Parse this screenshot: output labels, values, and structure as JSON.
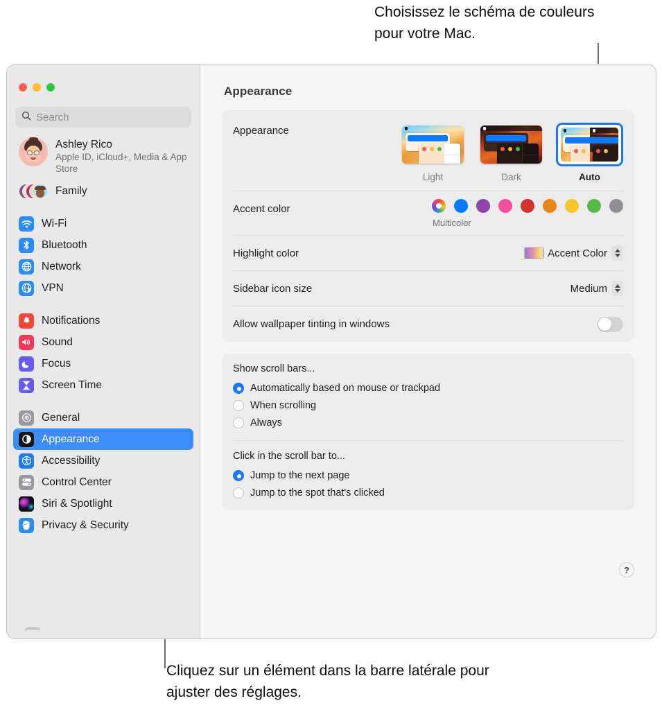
{
  "callouts": {
    "top": "Choisissez le schéma de couleurs pour votre Mac.",
    "bottom": "Cliquez sur un élément dans la barre latérale pour ajuster des réglages."
  },
  "window": {
    "title": "Appearance",
    "traffic_lights": [
      "close-button",
      "minimize-button",
      "zoom-button"
    ]
  },
  "sidebar": {
    "search": {
      "placeholder": "Search",
      "value": "",
      "icon": "search-icon"
    },
    "account": {
      "name": "Ashley Rico",
      "subtitle": "Apple ID, iCloud+, Media & App Store"
    },
    "family": {
      "label": "Family"
    },
    "groups": [
      {
        "items": [
          {
            "label": "Wi-Fi",
            "icon": "wifi-icon",
            "selected": false
          },
          {
            "label": "Bluetooth",
            "icon": "bluetooth-icon",
            "selected": false
          },
          {
            "label": "Network",
            "icon": "network-icon",
            "selected": false
          },
          {
            "label": "VPN",
            "icon": "vpn-icon",
            "selected": false
          }
        ]
      },
      {
        "items": [
          {
            "label": "Notifications",
            "icon": "notifications-icon",
            "selected": false
          },
          {
            "label": "Sound",
            "icon": "sound-icon",
            "selected": false
          },
          {
            "label": "Focus",
            "icon": "focus-icon",
            "selected": false
          },
          {
            "label": "Screen Time",
            "icon": "screen-time-icon",
            "selected": false
          }
        ]
      },
      {
        "items": [
          {
            "label": "General",
            "icon": "general-icon",
            "selected": false
          },
          {
            "label": "Appearance",
            "icon": "appearance-icon",
            "selected": true
          },
          {
            "label": "Accessibility",
            "icon": "accessibility-icon",
            "selected": false
          },
          {
            "label": "Control Center",
            "icon": "control-center-icon",
            "selected": false
          },
          {
            "label": "Siri & Spotlight",
            "icon": "siri-spotlight-icon",
            "selected": false
          },
          {
            "label": "Privacy & Security",
            "icon": "privacy-security-icon",
            "selected": false
          }
        ]
      }
    ]
  },
  "main": {
    "appearance": {
      "label": "Appearance",
      "options": [
        {
          "name": "Light",
          "selected": false
        },
        {
          "name": "Dark",
          "selected": false
        },
        {
          "name": "Auto",
          "selected": true
        }
      ]
    },
    "accent_color": {
      "label": "Accent color",
      "caption": "Multicolor",
      "swatches": [
        {
          "name": "Multicolor",
          "color": "multicolor",
          "selected": true
        },
        {
          "name": "Blue",
          "color": "#0a7bff"
        },
        {
          "name": "Purple",
          "color": "#8d45a8"
        },
        {
          "name": "Pink",
          "color": "#f2509e"
        },
        {
          "name": "Red",
          "color": "#d0342c"
        },
        {
          "name": "Orange",
          "color": "#e8861c"
        },
        {
          "name": "Yellow",
          "color": "#f5c72e"
        },
        {
          "name": "Green",
          "color": "#58b94a"
        },
        {
          "name": "Graphite",
          "color": "#8e8e93"
        }
      ]
    },
    "highlight_color": {
      "label": "Highlight color",
      "value": "Accent Color"
    },
    "sidebar_icon_size": {
      "label": "Sidebar icon size",
      "value": "Medium"
    },
    "wallpaper_tinting": {
      "label": "Allow wallpaper tinting in windows",
      "state": "off"
    },
    "show_scroll_bars": {
      "title": "Show scroll bars...",
      "options": [
        {
          "label": "Automatically based on mouse or trackpad",
          "selected": true
        },
        {
          "label": "When scrolling",
          "selected": false
        },
        {
          "label": "Always",
          "selected": false
        }
      ]
    },
    "click_scroll_bar": {
      "title": "Click in the scroll bar to...",
      "options": [
        {
          "label": "Jump to the next page",
          "selected": true
        },
        {
          "label": "Jump to the spot that's clicked",
          "selected": false
        }
      ]
    },
    "help_button": {
      "label": "?"
    }
  }
}
